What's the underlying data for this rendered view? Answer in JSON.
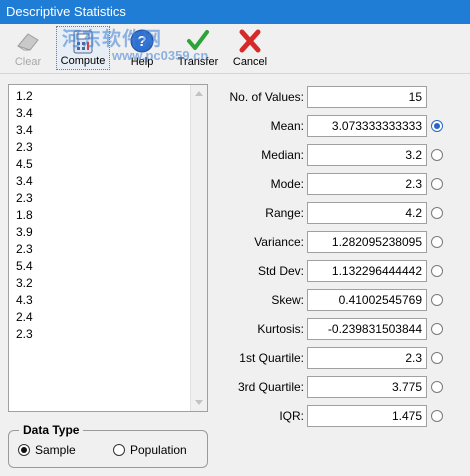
{
  "window": {
    "title": "Descriptive Statistics"
  },
  "watermark": {
    "line1": "河东软件网",
    "line2": "www.pc0359.cn"
  },
  "toolbar": {
    "clear_label": "Clear",
    "compute_label": "Compute",
    "help_label": "Help",
    "transfer_label": "Transfer",
    "cancel_label": "Cancel"
  },
  "data_values": [
    "1.2",
    "3.4",
    "3.4",
    "2.3",
    "4.5",
    "3.4",
    "2.3",
    "1.8",
    "3.9",
    "2.3",
    "5.4",
    "3.2",
    "4.3",
    "2.4",
    "2.3"
  ],
  "data_type": {
    "legend": "Data Type",
    "sample_label": "Sample",
    "population_label": "Population",
    "selected": "Sample"
  },
  "stats": [
    {
      "label": "No. of Values:",
      "value": "15",
      "radio": false
    },
    {
      "label": "Mean:",
      "value": "3.073333333333",
      "radio": true,
      "selected": true
    },
    {
      "label": "Median:",
      "value": "3.2",
      "radio": true
    },
    {
      "label": "Mode:",
      "value": "2.3",
      "radio": true
    },
    {
      "label": "Range:",
      "value": "4.2",
      "radio": true
    },
    {
      "label": "Variance:",
      "value": "1.282095238095",
      "radio": true
    },
    {
      "label": "Std Dev:",
      "value": "1.132296444442",
      "radio": true
    },
    {
      "label": "Skew:",
      "value": "0.41002545769",
      "radio": true
    },
    {
      "label": "Kurtosis:",
      "value": "-0.239831503844",
      "radio": true
    },
    {
      "label": "1st Quartile:",
      "value": "2.3",
      "radio": true
    },
    {
      "label": "3rd Quartile:",
      "value": "3.775",
      "radio": true
    },
    {
      "label": "IQR:",
      "value": "1.475",
      "radio": true
    }
  ]
}
